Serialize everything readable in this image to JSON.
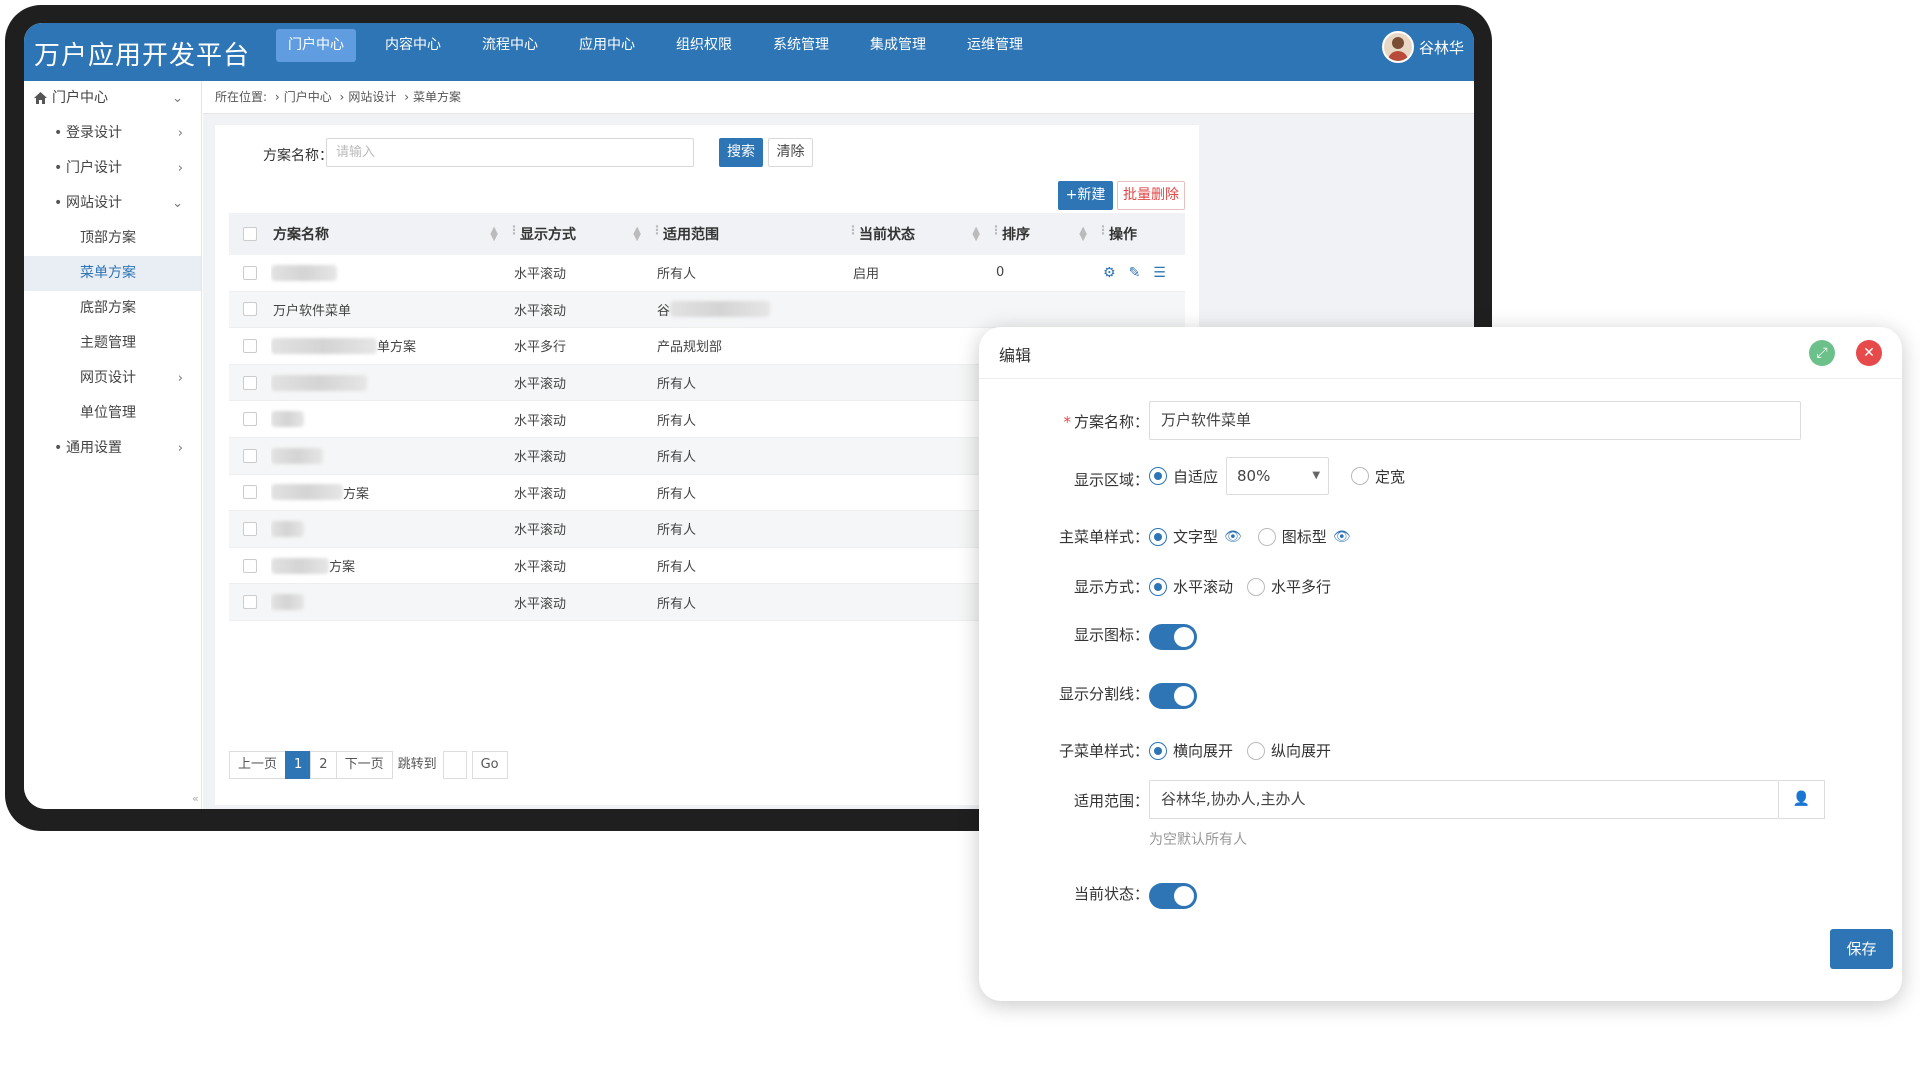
{
  "app": {
    "title": "万户应用开发平台",
    "user_name": "谷林华"
  },
  "nav": [
    "门户中心",
    "内容中心",
    "流程中心",
    "应用中心",
    "组织权限",
    "系统管理",
    "集成管理",
    "运维管理"
  ],
  "sidebar": {
    "header": "门户中心",
    "items": [
      {
        "label": "登录设计",
        "chev": "›"
      },
      {
        "label": "门户设计",
        "chev": "›"
      },
      {
        "label": "网站设计",
        "chev": "⌄"
      },
      {
        "label": "顶部方案"
      },
      {
        "label": "菜单方案"
      },
      {
        "label": "底部方案"
      },
      {
        "label": "主题管理"
      },
      {
        "label": "网页设计",
        "chev": "›"
      },
      {
        "label": "单位管理"
      },
      {
        "label": "通用设置",
        "chev": "›"
      }
    ]
  },
  "breadcrumb": {
    "prefix": "所在位置:",
    "items": [
      "门户中心",
      "网站设计",
      "菜单方案"
    ]
  },
  "search": {
    "label": "方案名称：",
    "placeholder": "请输入",
    "search_btn": "搜索",
    "clear_btn": "清除"
  },
  "toolbar": {
    "new_btn": "+新建",
    "batch_delete_btn": "批量删除"
  },
  "table": {
    "columns": [
      "方案名称",
      "显示方式",
      "适用范围",
      "当前状态",
      "排序",
      "操作"
    ],
    "rows": [
      {
        "name": "",
        "mode": "水平滚动",
        "scope": "所有人",
        "status": "启用",
        "order": "0"
      },
      {
        "name": "万户软件菜单",
        "mode": "水平滚动",
        "scope": "谷",
        "status": "",
        "order": ""
      },
      {
        "name": "单方案",
        "mode": "水平多行",
        "scope": "产品规划部",
        "status": "",
        "order": ""
      },
      {
        "name": "",
        "mode": "水平滚动",
        "scope": "所有人",
        "status": "",
        "order": ""
      },
      {
        "name": "",
        "mode": "水平滚动",
        "scope": "所有人",
        "status": "",
        "order": ""
      },
      {
        "name": "",
        "mode": "水平滚动",
        "scope": "所有人",
        "status": "",
        "order": ""
      },
      {
        "name": "方案",
        "mode": "水平滚动",
        "scope": "所有人",
        "status": "",
        "order": ""
      },
      {
        "name": "",
        "mode": "水平滚动",
        "scope": "所有人",
        "status": "",
        "order": ""
      },
      {
        "name": "方案",
        "mode": "水平滚动",
        "scope": "所有人",
        "status": "",
        "order": ""
      },
      {
        "name": "",
        "mode": "水平滚动",
        "scope": "所有人",
        "status": "",
        "order": ""
      }
    ]
  },
  "pager": {
    "prev": "上一页",
    "pages": [
      "1",
      "2"
    ],
    "current": "1",
    "next": "下一页",
    "jump_label": "跳转到",
    "go": "Go"
  },
  "modal": {
    "title": "编辑",
    "fields": {
      "name_label": "方案名称：",
      "name_value": "万户软件菜单",
      "area_label": "显示区域：",
      "area_opt1": "自适应",
      "area_select": "80%",
      "area_opt2": "定宽",
      "style_label": "主菜单样式：",
      "style_opt1": "文字型",
      "style_opt2": "图标型",
      "mode_label": "显示方式：",
      "mode_opt1": "水平滚动",
      "mode_opt2": "水平多行",
      "icon_label": "显示图标：",
      "divider_label": "显示分割线：",
      "sub_label": "子菜单样式：",
      "sub_opt1": "横向展开",
      "sub_opt2": "纵向展开",
      "scope_label": "适用范围：",
      "scope_value": "谷林华,协办人,主办人",
      "scope_hint": "为空默认所有人",
      "status_label": "当前状态："
    },
    "states": {
      "icon_on": true,
      "divider_on": true,
      "status_on": true
    },
    "save_btn": "保存"
  },
  "colors": {
    "primary": "#2e75b6",
    "danger": "#e04848",
    "expand": "#6cc08a"
  }
}
